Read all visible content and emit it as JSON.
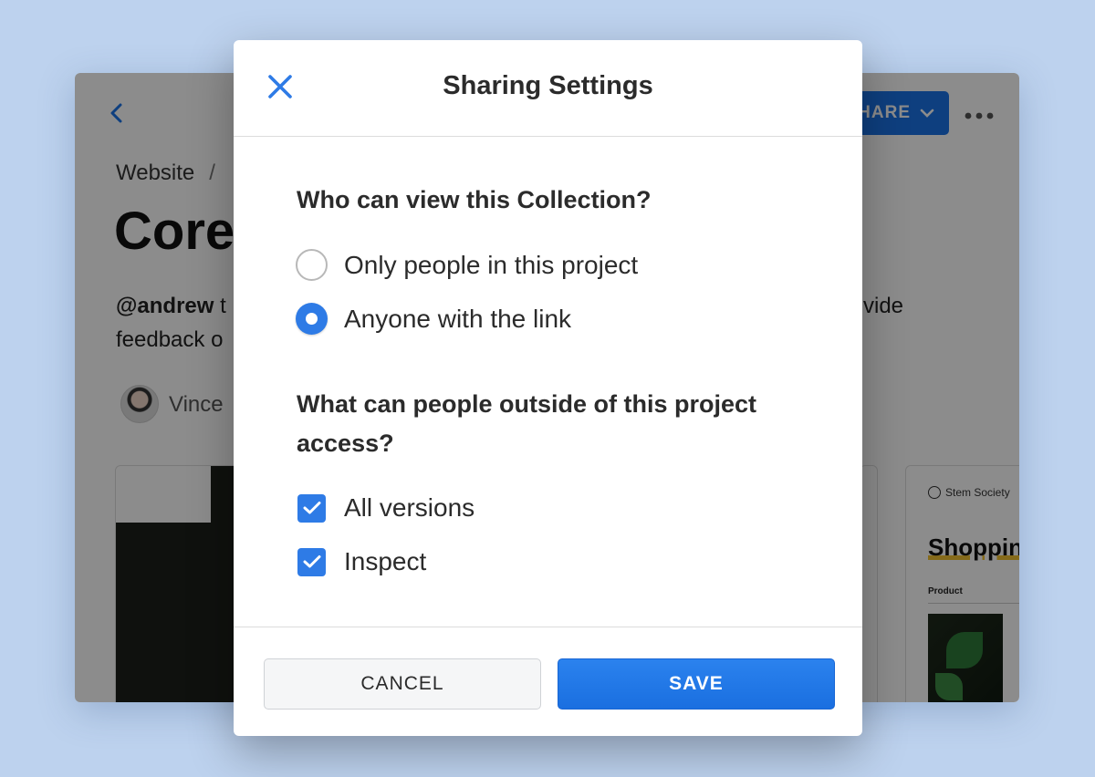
{
  "background_app": {
    "back_icon": "chevron-left-icon",
    "share_label": "SHARE",
    "more_icon": "more-horizontal-icon",
    "breadcrumb": "Website",
    "breadcrumb_sep": "/",
    "title": "Core",
    "description_mention": "@andrew",
    "description_rest": " t",
    "description_right": "vide",
    "description_line2": "feedback o",
    "author": "Vince",
    "card_brand": "Stem Society",
    "card_heading": "Shopping",
    "card_product": "Product"
  },
  "modal": {
    "title": "Sharing Settings",
    "close_icon": "close-icon",
    "question_view": "Who can view this Collection?",
    "view_options": [
      {
        "label": "Only people in this project",
        "checked": false
      },
      {
        "label": "Anyone with the link",
        "checked": true
      }
    ],
    "question_access": "What can people outside of this project access?",
    "access_options": [
      {
        "label": "All versions",
        "checked": true
      },
      {
        "label": "Inspect",
        "checked": true
      }
    ],
    "cancel_label": "CANCEL",
    "save_label": "SAVE"
  },
  "colors": {
    "accent": "#2e7be6",
    "page_background": "#bdd2ee"
  }
}
